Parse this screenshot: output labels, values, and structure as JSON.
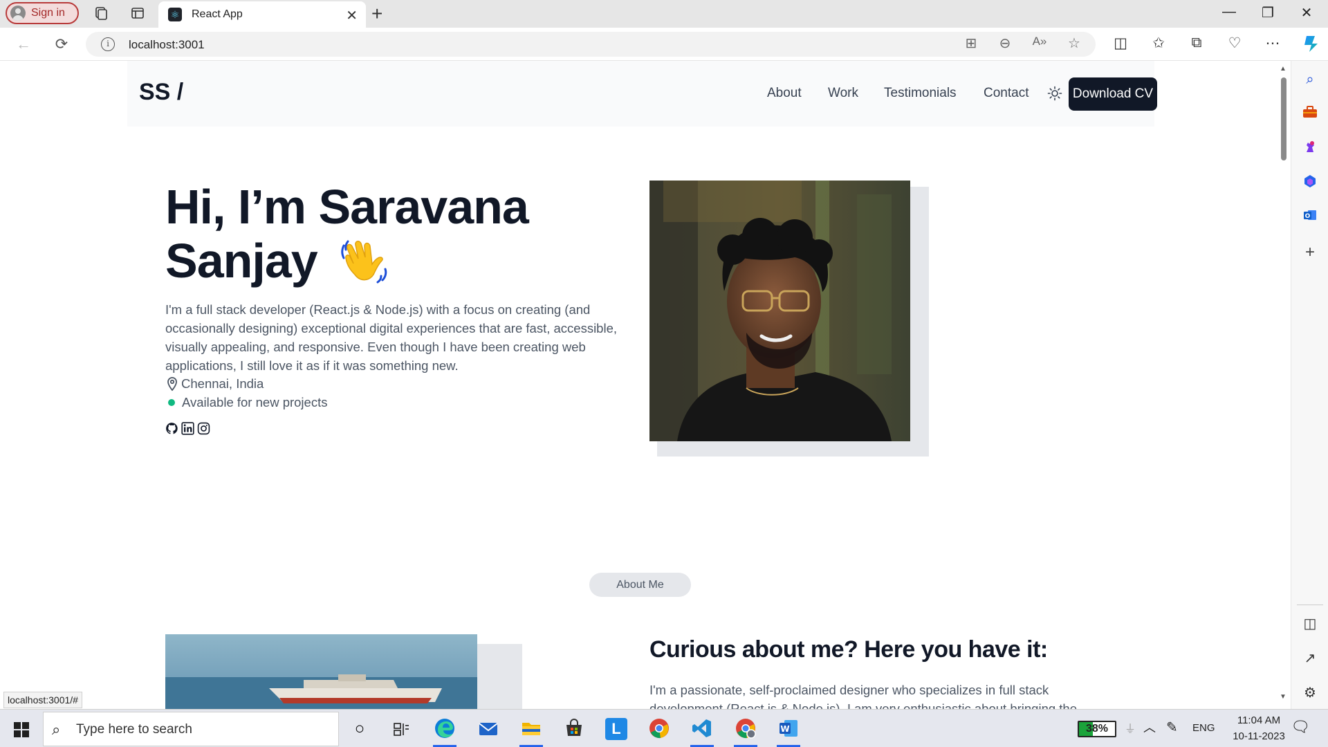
{
  "browser": {
    "sign_in_label": "Sign in",
    "tab_title": "React App",
    "url": "localhost:3001",
    "status_link": "localhost:3001/#"
  },
  "navbar": {
    "logo": "SS /",
    "links": [
      "About",
      "Work",
      "Testimonials",
      "Contact"
    ],
    "cta_label": "Download CV"
  },
  "hero": {
    "title_line1": "Hi, I’m Saravana",
    "title_line2": "Sanjay",
    "description": "I'm a full stack developer (React.js & Node.js) with a focus on creating (and occasionally designing) exceptional digital experiences that are fast, accessible, visually appealing, and responsive. Even though I have been creating web applications, I still love it as if it was something new.",
    "location": "Chennai, India",
    "availability": "Available for new projects",
    "socials": [
      "github-icon",
      "linkedin-icon",
      "instagram-icon"
    ],
    "availability_color": "#10b981"
  },
  "about": {
    "pill": "About Me",
    "title": "Curious about me? Here you have it:",
    "text": "I'm a passionate, self-proclaimed designer who specializes in full stack development (React.js & Node.js). I am very enthusiastic about bringing the"
  },
  "taskbar": {
    "search_placeholder": "Type here to search",
    "battery": "38%",
    "language": "ENG",
    "time": "11:04 AM",
    "date": "10-11-2023"
  },
  "colors": {
    "accent_dark": "#111827",
    "text_muted": "#4b5563",
    "sign_in_border": "#b83a3a"
  }
}
